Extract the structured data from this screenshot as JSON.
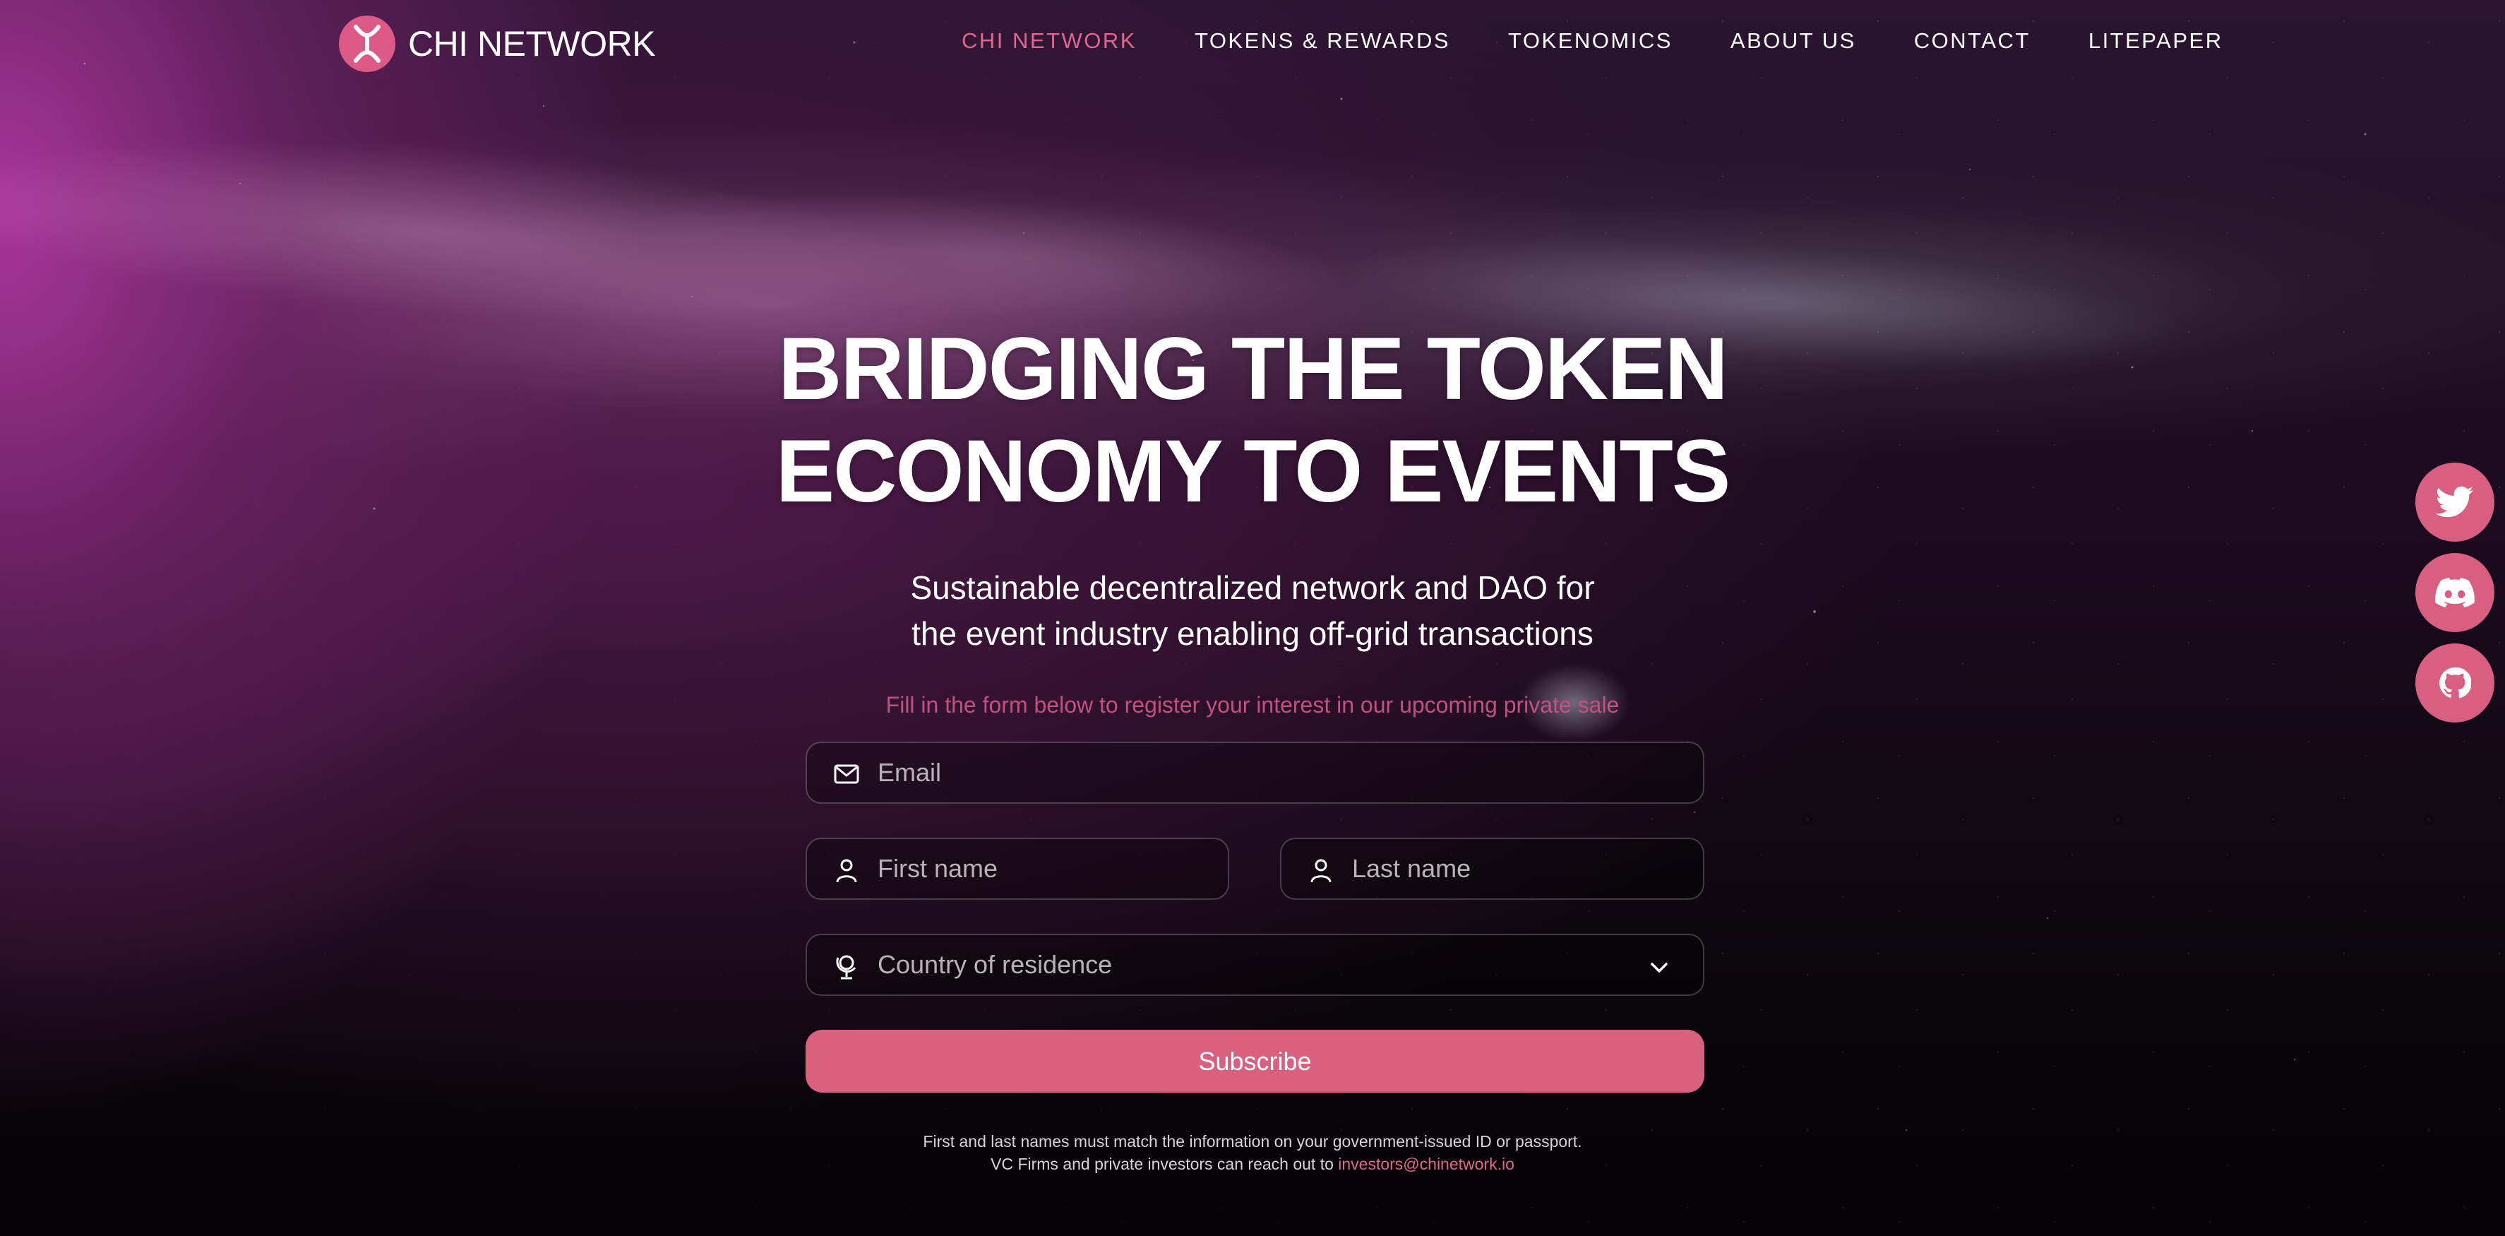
{
  "brand": {
    "name": "CHI NETWORK",
    "accent": "#dd5a86"
  },
  "nav": {
    "items": [
      {
        "label": "CHI NETWORK",
        "active": true
      },
      {
        "label": "TOKENS & REWARDS",
        "active": false
      },
      {
        "label": "TOKENOMICS",
        "active": false
      },
      {
        "label": "ABOUT US",
        "active": false
      },
      {
        "label": "CONTACT",
        "active": false
      },
      {
        "label": "LITEPAPER",
        "active": false
      }
    ]
  },
  "hero": {
    "title_line1": "BRIDGING THE TOKEN",
    "title_line2": "ECONOMY TO EVENTS",
    "subtitle_line1": "Sustainable decentralized network and DAO for",
    "subtitle_line2": "the event industry enabling off-grid transactions",
    "note": "Fill in the form below to register your interest in our upcoming private sale"
  },
  "form": {
    "email": {
      "placeholder": "Email",
      "icon": "envelope-icon"
    },
    "first_name": {
      "placeholder": "First name",
      "icon": "user-icon"
    },
    "last_name": {
      "placeholder": "Last name",
      "icon": "user-icon"
    },
    "country": {
      "placeholder": "Country of residence",
      "icon": "globe-icon"
    },
    "submit_label": "Subscribe"
  },
  "footer": {
    "line1": "First and last names must match the information on your government-issued ID or passport.",
    "line2_prefix": "VC Firms and private investors can reach out to ",
    "email_link": "investors@chinetwork.io"
  },
  "socials": [
    {
      "name": "twitter",
      "icon": "twitter-icon"
    },
    {
      "name": "discord",
      "icon": "discord-icon"
    },
    {
      "name": "github",
      "icon": "github-icon"
    }
  ]
}
